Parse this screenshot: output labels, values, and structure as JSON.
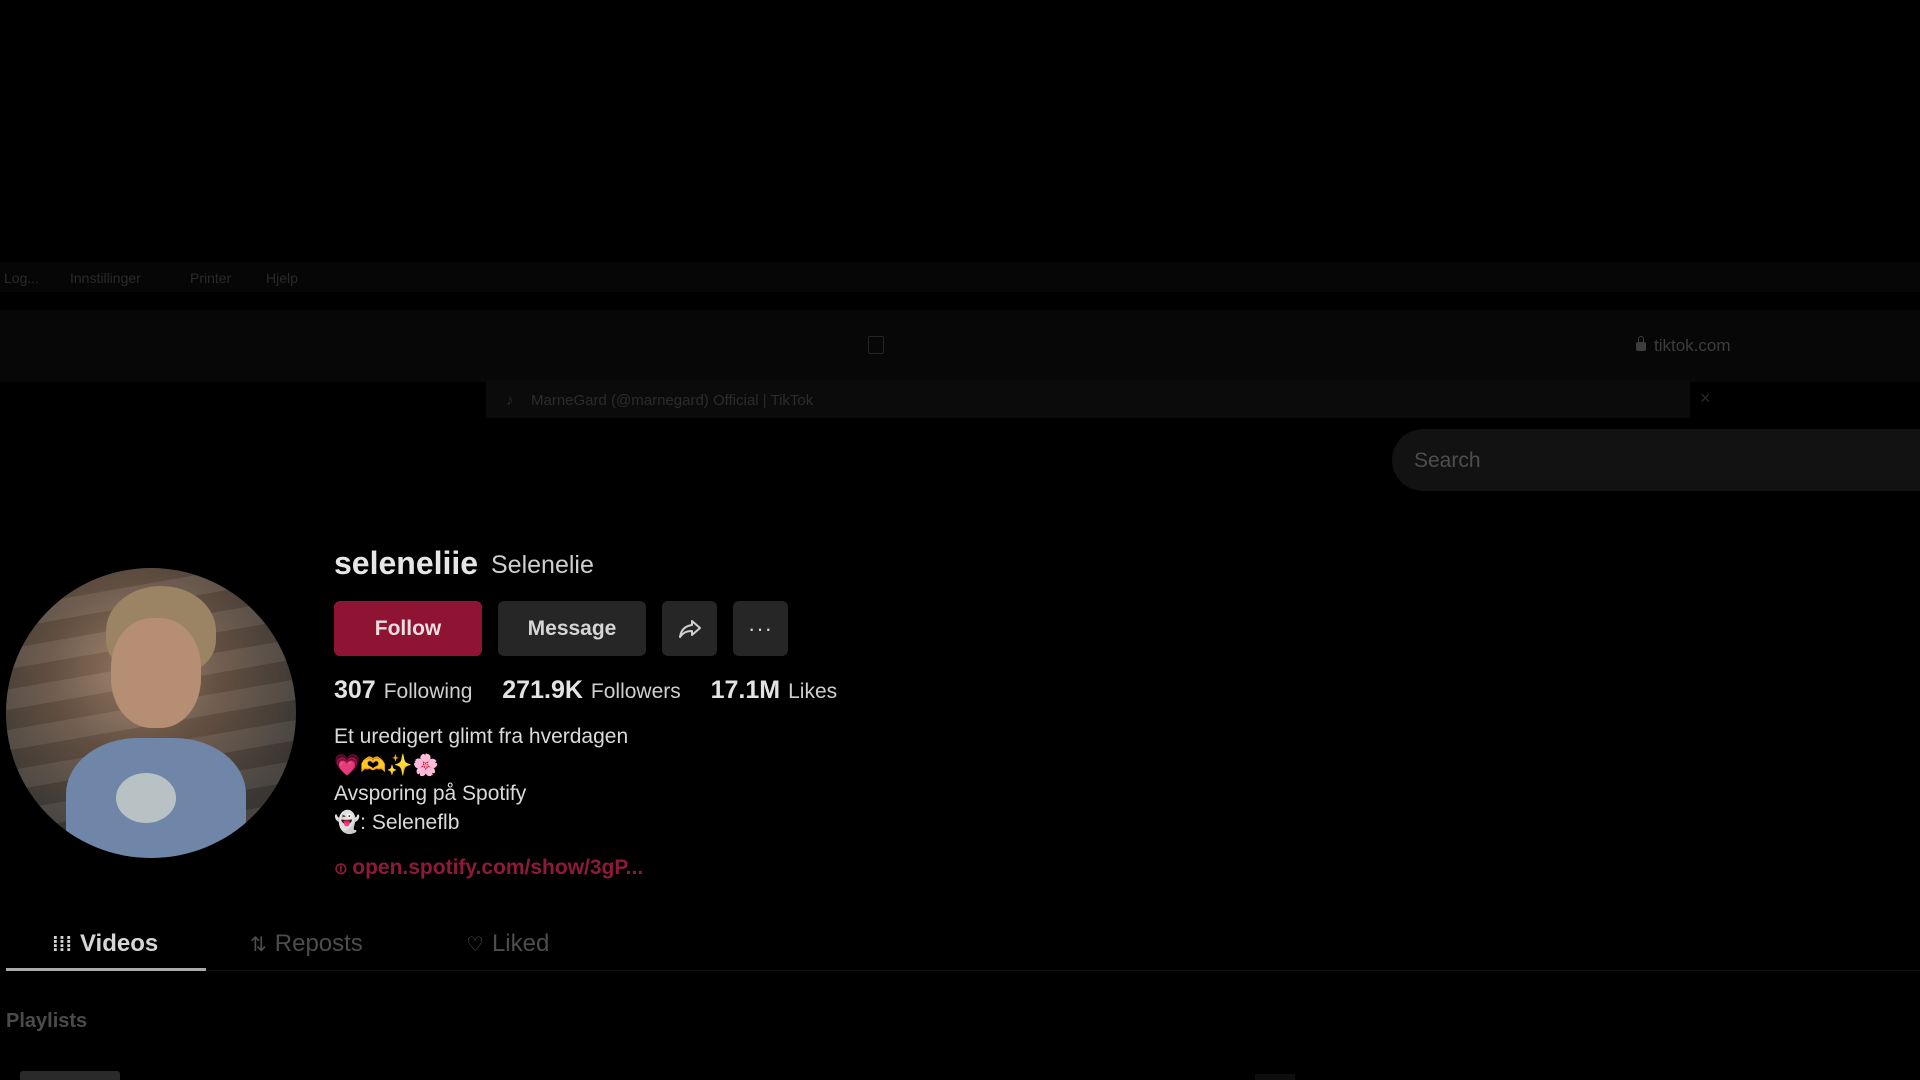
{
  "browser": {
    "bookmarks": [
      "Log...",
      "Innstillinger",
      "Printer",
      "Hjelp"
    ],
    "url": "tiktok.com",
    "tab_title": "MarneGard (@marnegard) Official | TikTok",
    "tab_close": "×"
  },
  "search": {
    "placeholder": "Search"
  },
  "profile": {
    "username": "seleneliie",
    "nickname": "Selenelie",
    "follow_label": "Follow",
    "message_label": "Message",
    "more_label": "···",
    "stats": {
      "following_count": "307",
      "following_label": "Following",
      "followers_count": "271.9K",
      "followers_label": "Followers",
      "likes_count": "17.1M",
      "likes_label": "Likes"
    },
    "bio": [
      "Et uredigert glimt fra hverdagen",
      "💗🫶✨🌸",
      "Avsporing på Spotify",
      "👻: Seleneflb"
    ],
    "link": "open.spotify.com/show/3gP..."
  },
  "tabs": {
    "videos": "Videos",
    "reposts": "Reposts",
    "liked": "Liked"
  },
  "sections": {
    "playlists": "Playlists"
  },
  "colors": {
    "follow_button": "#8f1434",
    "link": "#8e1a3a",
    "background": "#000000"
  }
}
